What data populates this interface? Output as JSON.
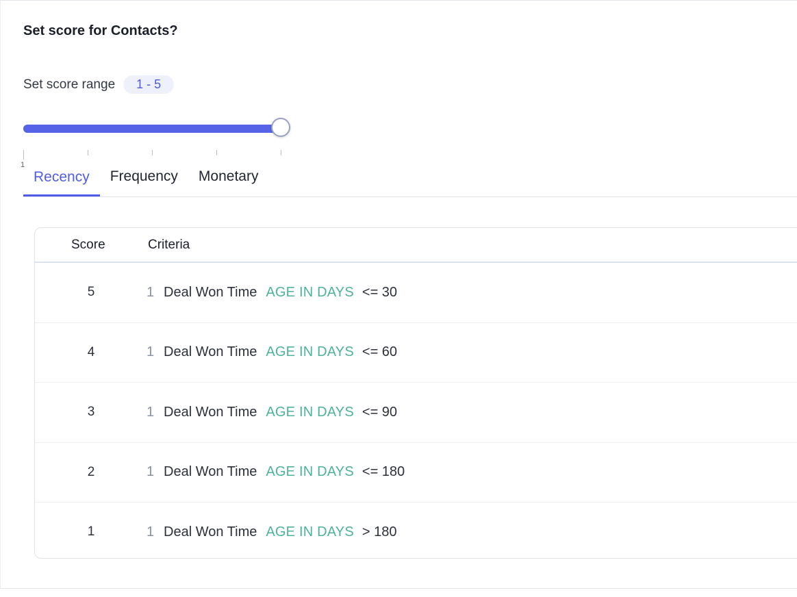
{
  "title": "Set score for Contacts?",
  "score_range": {
    "label": "Set score range",
    "value": "1 - 5",
    "slider_fill_fraction": 1.0,
    "tick_count": 5,
    "min_tick_label": "1"
  },
  "tabs": [
    {
      "label": "Recency",
      "active": true
    },
    {
      "label": "Frequency",
      "active": false
    },
    {
      "label": "Monetary",
      "active": false
    }
  ],
  "table": {
    "headers": {
      "score": "Score",
      "criteria": "Criteria"
    },
    "rows": [
      {
        "score": "5",
        "index": "1",
        "field": "Deal Won Time",
        "operator": "AGE IN DAYS",
        "value": "<= 30"
      },
      {
        "score": "4",
        "index": "1",
        "field": "Deal Won Time",
        "operator": "AGE IN DAYS",
        "value": "<= 60"
      },
      {
        "score": "3",
        "index": "1",
        "field": "Deal Won Time",
        "operator": "AGE IN DAYS",
        "value": "<= 90"
      },
      {
        "score": "2",
        "index": "1",
        "field": "Deal Won Time",
        "operator": "AGE IN DAYS",
        "value": "<= 180"
      },
      {
        "score": "1",
        "index": "1",
        "field": "Deal Won Time",
        "operator": "AGE IN DAYS",
        "value": "> 180"
      }
    ]
  },
  "colors": {
    "accent": "#4f5de6",
    "operator": "#4db399",
    "badge_bg": "#eef1fb"
  }
}
